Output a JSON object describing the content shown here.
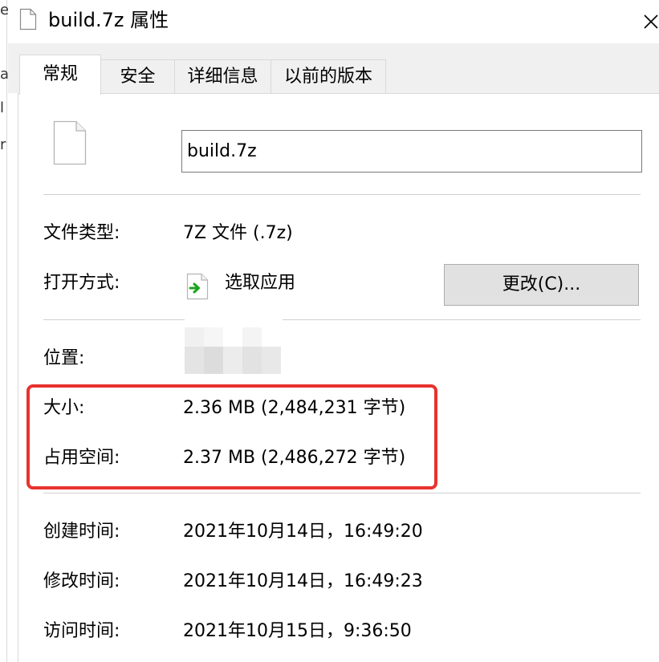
{
  "window": {
    "title": "build.7z 属性"
  },
  "left_strip": {
    "glyphs": [
      "e",
      "a",
      "l",
      "r"
    ]
  },
  "tabs": [
    {
      "label": "常规",
      "active": true
    },
    {
      "label": "安全",
      "active": false
    },
    {
      "label": "详细信息",
      "active": false
    },
    {
      "label": "以前的版本",
      "active": false
    }
  ],
  "general": {
    "file_name": "build.7z",
    "file_type_label": "文件类型:",
    "file_type_value": "7Z 文件 (.7z)",
    "opens_with_label": "打开方式:",
    "opens_with_value": "选取应用",
    "change_button": "更改(C)...",
    "location_label": "位置:",
    "size_label": "大小:",
    "size_value": "2.36 MB (2,484,231 字节)",
    "disk_size_label": "占用空间:",
    "disk_size_value": "2.37 MB (2,486,272 字节)",
    "created_label": "创建时间:",
    "created_value": "2021年10月14日，16:49:20",
    "modified_label": "修改时间:",
    "modified_value": "2021年10月14日，16:49:23",
    "accessed_label": "访问时间:",
    "accessed_value": "2021年10月15日，9:36:50"
  },
  "colors": {
    "highlight": "#e8322e",
    "tab_bg": "#f0f0f0",
    "button_bg": "#e1e1e1",
    "arrow_green": "#1aa51a"
  }
}
